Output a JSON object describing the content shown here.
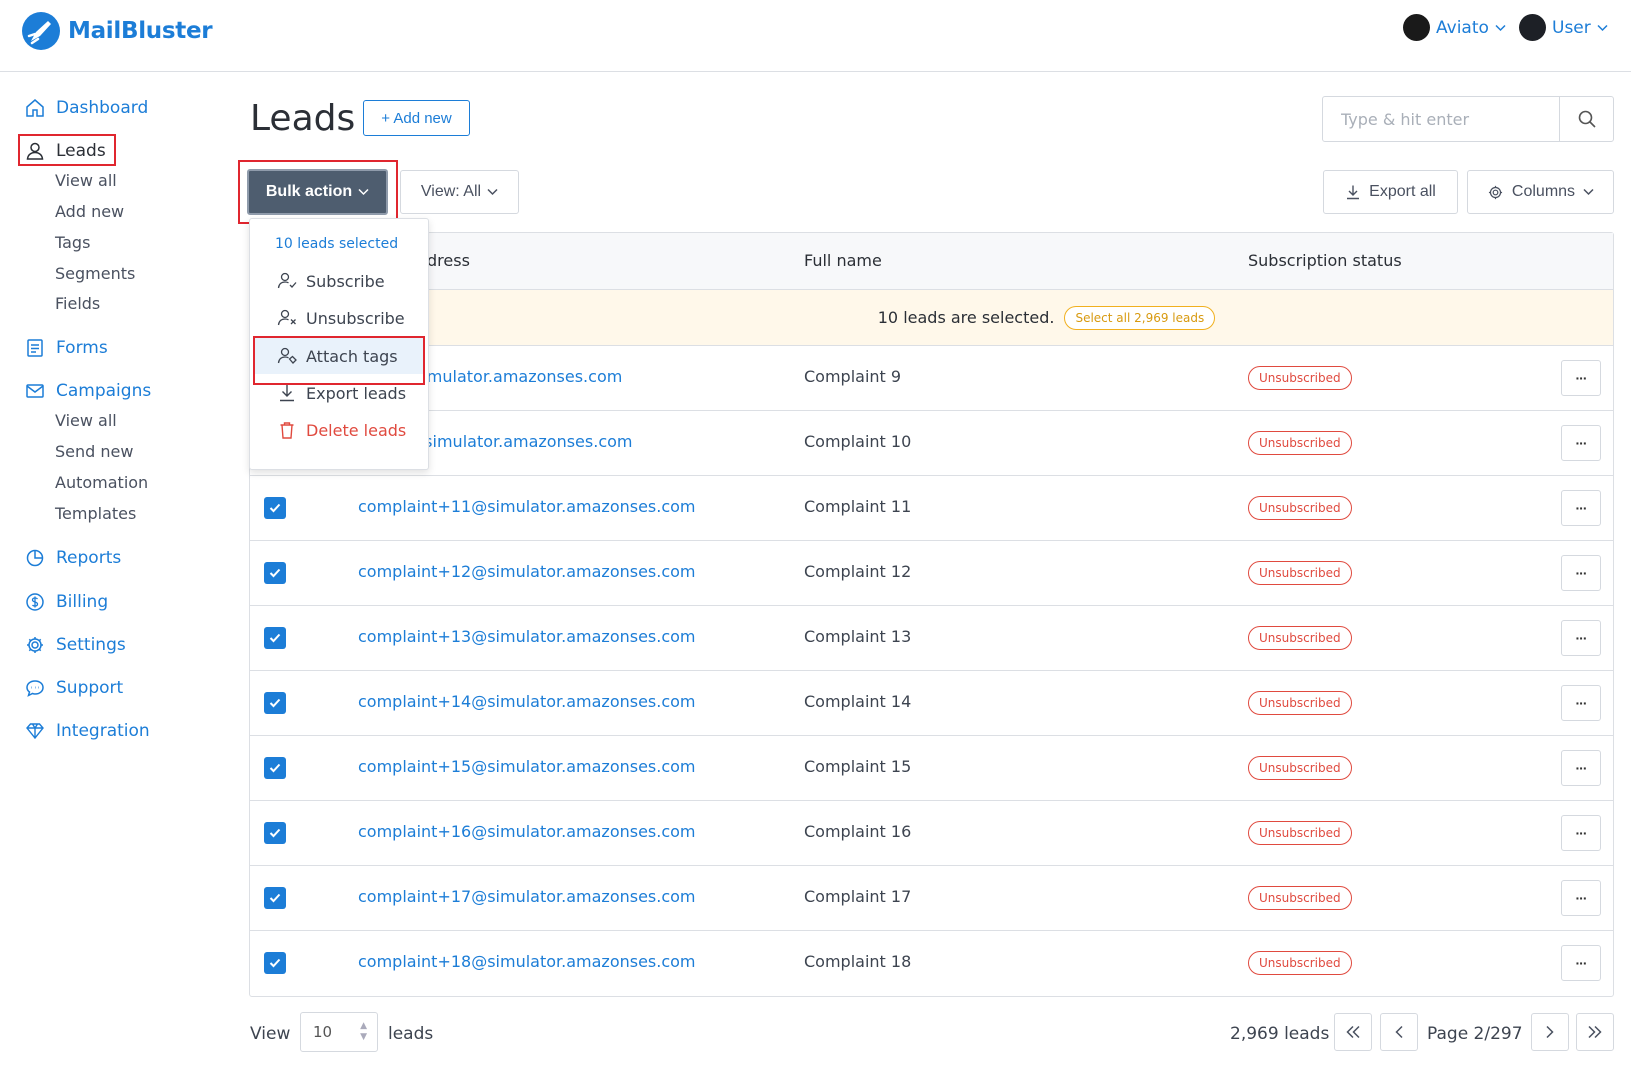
{
  "brand": {
    "name": "MailBluster",
    "color": "#1c7dd7"
  },
  "header": {
    "org_label": "Aviato",
    "user_label": "User"
  },
  "sidebar": {
    "dashboard": "Dashboard",
    "leads": "Leads",
    "leads_sub": [
      "View all",
      "Add new",
      "Tags",
      "Segments",
      "Fields"
    ],
    "forms": "Forms",
    "campaigns": "Campaigns",
    "campaigns_sub": [
      "View all",
      "Send new",
      "Automation",
      "Templates"
    ],
    "reports": "Reports",
    "billing": "Billing",
    "settings": "Settings",
    "support": "Support",
    "integration": "Integration"
  },
  "page": {
    "title": "Leads",
    "add_new": "+ Add new"
  },
  "search": {
    "placeholder": "Type & hit enter"
  },
  "toolbar": {
    "bulk_action": "Bulk action",
    "view_filter": "View: All",
    "export_all": "Export all",
    "columns": "Columns"
  },
  "bulk_menu": {
    "header": "10 leads selected",
    "items": [
      "Subscribe",
      "Unsubscribe",
      "Attach tags",
      "Export leads",
      "Delete leads"
    ]
  },
  "table": {
    "columns": [
      "Email address",
      "Full name",
      "Subscription status"
    ],
    "column_visible_partial": "dress",
    "selection_banner": "10 leads are selected.",
    "select_all": "Select all 2,969 leads",
    "rows": [
      {
        "email": "complaint+9@simulator.amazonses.com",
        "email_visible": "nt+9@simulator.amazonses.com",
        "name": "Complaint 9",
        "status": "Unsubscribed"
      },
      {
        "email": "complaint+10@simulator.amazonses.com",
        "email_visible": "nt+10@simulator.amazonses.com",
        "name": "Complaint 10",
        "status": "Unsubscribed"
      },
      {
        "email": "complaint+11@simulator.amazonses.com",
        "email_visible": "complaint+11@simulator.amazonses.com",
        "name": "Complaint 11",
        "status": "Unsubscribed"
      },
      {
        "email": "complaint+12@simulator.amazonses.com",
        "email_visible": "complaint+12@simulator.amazonses.com",
        "name": "Complaint 12",
        "status": "Unsubscribed"
      },
      {
        "email": "complaint+13@simulator.amazonses.com",
        "email_visible": "complaint+13@simulator.amazonses.com",
        "name": "Complaint 13",
        "status": "Unsubscribed"
      },
      {
        "email": "complaint+14@simulator.amazonses.com",
        "email_visible": "complaint+14@simulator.amazonses.com",
        "name": "Complaint 14",
        "status": "Unsubscribed"
      },
      {
        "email": "complaint+15@simulator.amazonses.com",
        "email_visible": "complaint+15@simulator.amazonses.com",
        "name": "Complaint 15",
        "status": "Unsubscribed"
      },
      {
        "email": "complaint+16@simulator.amazonses.com",
        "email_visible": "complaint+16@simulator.amazonses.com",
        "name": "Complaint 16",
        "status": "Unsubscribed"
      },
      {
        "email": "complaint+17@simulator.amazonses.com",
        "email_visible": "complaint+17@simulator.amazonses.com",
        "name": "Complaint 17",
        "status": "Unsubscribed"
      },
      {
        "email": "complaint+18@simulator.amazonses.com",
        "email_visible": "complaint+18@simulator.amazonses.com",
        "name": "Complaint 18",
        "status": "Unsubscribed"
      }
    ]
  },
  "pagination": {
    "view_label": "View",
    "per_page": "10",
    "leads_label": "leads",
    "total": "2,969 leads",
    "page_label": "Page 2/297"
  }
}
